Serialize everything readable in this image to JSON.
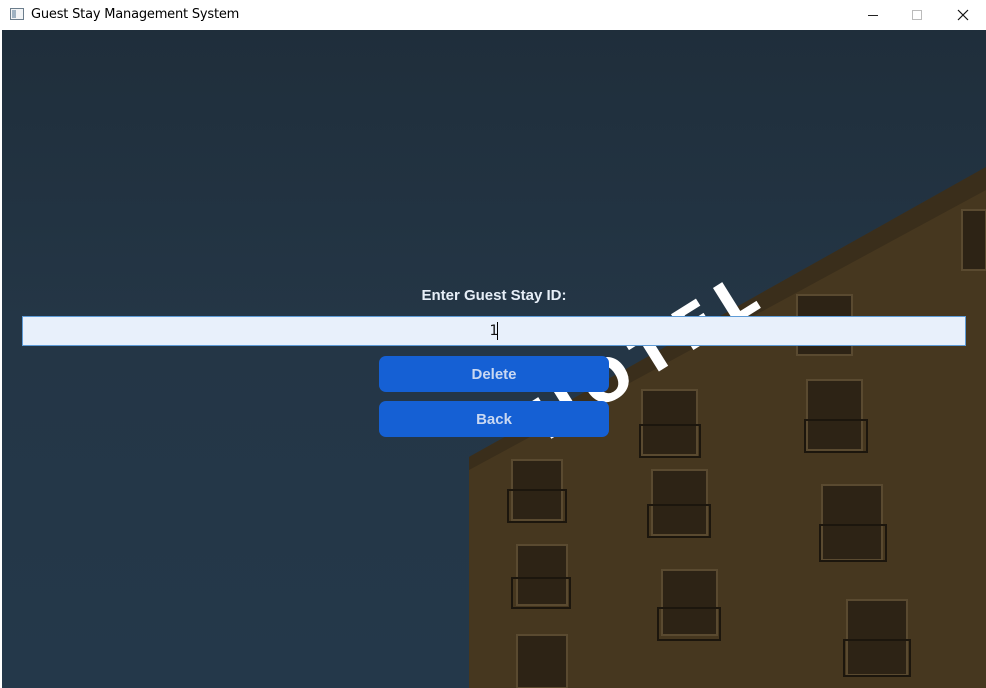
{
  "window": {
    "title": "Guest Stay Management System"
  },
  "form": {
    "label": "Enter Guest Stay ID:",
    "guest_stay_id_value": "1",
    "delete_label": "Delete",
    "back_label": "Back"
  },
  "background": {
    "sign_text": "HOTEL"
  },
  "colors": {
    "button": "#1560d4",
    "input_bg": "#e8f0fb",
    "sky": "#23364a",
    "building": "#4a3a22"
  }
}
